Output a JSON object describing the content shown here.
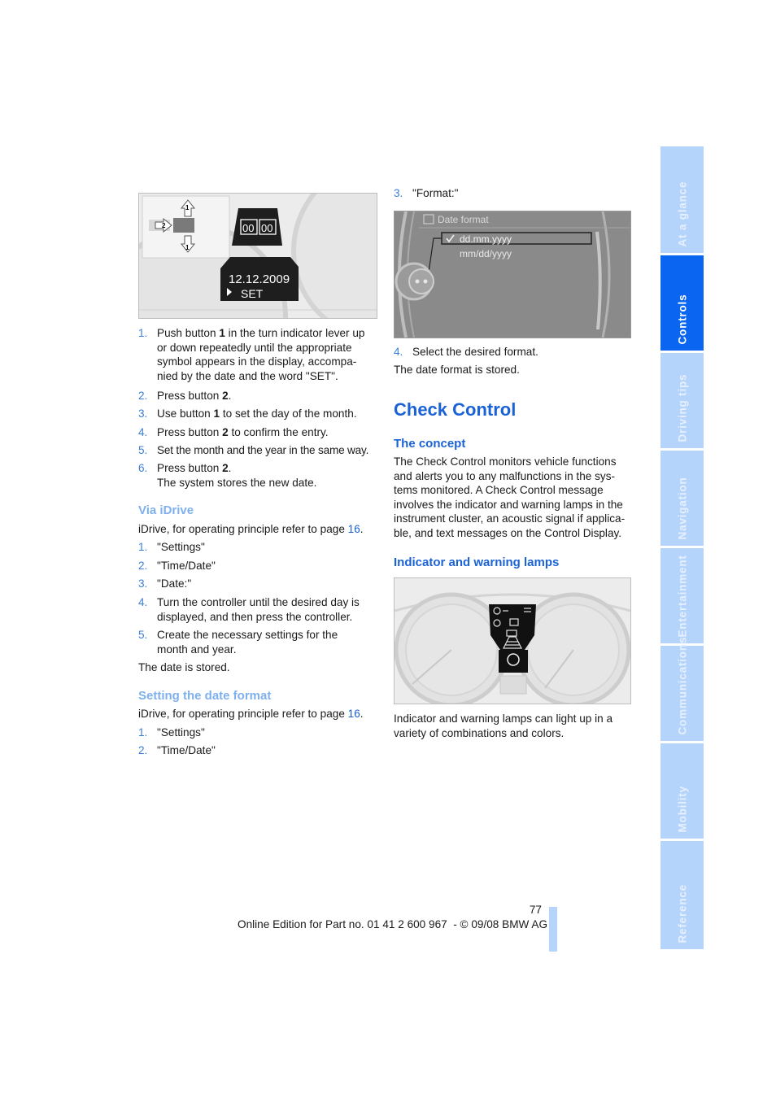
{
  "left_column": {
    "figure1": {
      "display_date": "12.12.2009",
      "display_set": "SET",
      "counter_digits": [
        "00",
        "00"
      ],
      "button_labels": [
        "1",
        "2",
        "1"
      ]
    },
    "steps1": [
      {
        "n": "1.",
        "text_pre": "Push button ",
        "bold": "1",
        "text_post": " in the turn indicator lever up or down repeatedly until the appropriate symbol appears in the display, accompa-nied by the date and the word \"SET\"."
      },
      {
        "n": "2.",
        "text_pre": "Press button ",
        "bold": "2",
        "text_post": "."
      },
      {
        "n": "3.",
        "text_pre": "Use button ",
        "bold": "1",
        "text_post": " to set the day of the month."
      },
      {
        "n": "4.",
        "text_pre": "Press button ",
        "bold": "2",
        "text_post": " to confirm the entry."
      },
      {
        "n": "5.",
        "text_pre": "Set the month and the year in the same way.",
        "bold": "",
        "text_post": ""
      },
      {
        "n": "6.",
        "text_pre": "Press button ",
        "bold": "2",
        "text_post": ".",
        "extra": "The system stores the new date."
      }
    ],
    "via_idrive": {
      "heading": "Via iDrive",
      "intro": "iDrive, for operating principle refer to page ",
      "page_link": "16",
      "steps": [
        {
          "n": "1.",
          "text": "\"Settings\""
        },
        {
          "n": "2.",
          "text": "\"Time/Date\""
        },
        {
          "n": "3.",
          "text": "\"Date:\""
        },
        {
          "n": "4.",
          "text": "Turn the controller until the desired day is displayed, and then press the controller."
        },
        {
          "n": "5.",
          "text": "Create the necessary settings for the month and year."
        }
      ],
      "result": "The date is stored."
    },
    "date_format": {
      "heading": "Setting the date format",
      "intro": "iDrive, for operating principle refer to page ",
      "page_link": "16",
      "steps": [
        {
          "n": "1.",
          "text": "\"Settings\""
        },
        {
          "n": "2.",
          "text": "\"Time/Date\""
        }
      ]
    }
  },
  "right_column": {
    "step3": {
      "n": "3.",
      "text": "\"Format:\""
    },
    "screen": {
      "title": "Date format",
      "options": [
        {
          "label": "dd.mm.yyyy",
          "selected": true
        },
        {
          "label": "mm/dd/yyyy",
          "selected": false
        }
      ]
    },
    "step4": {
      "n": "4.",
      "text": "Select the desired format."
    },
    "step4_result": "The date format is stored.",
    "section_title": "Check Control",
    "concept_heading": "The concept",
    "concept_text": "The Check Control monitors vehicle functions and alerts you to any malfunctions in the sys-tems monitored. A Check Control message involves the indicator and warning lamps in the instrument cluster, an acoustic signal if applica-ble, and text messages on the Control Display.",
    "lamps_heading": "Indicator and warning lamps",
    "lamps_text": "Indicator and warning lamps can light up in a variety of combinations and colors."
  },
  "footer": {
    "page_number": "77",
    "edition": "Online Edition for Part no. 01 41 2 600 967  - © 09/08 BMW AG"
  },
  "side_tabs": [
    {
      "label": "At a glance",
      "active": false
    },
    {
      "label": "Controls",
      "active": true
    },
    {
      "label": "Driving tips",
      "active": false
    },
    {
      "label": "Navigation",
      "active": false
    },
    {
      "label": "Entertainment",
      "active": false
    },
    {
      "label": "Communications",
      "active": false
    },
    {
      "label": "Mobility",
      "active": false
    },
    {
      "label": "Reference",
      "active": false
    }
  ],
  "colors": {
    "accent": "#1a62d6",
    "tab_active": "#0a66f0",
    "tab_inactive": "#b5d4fb"
  }
}
